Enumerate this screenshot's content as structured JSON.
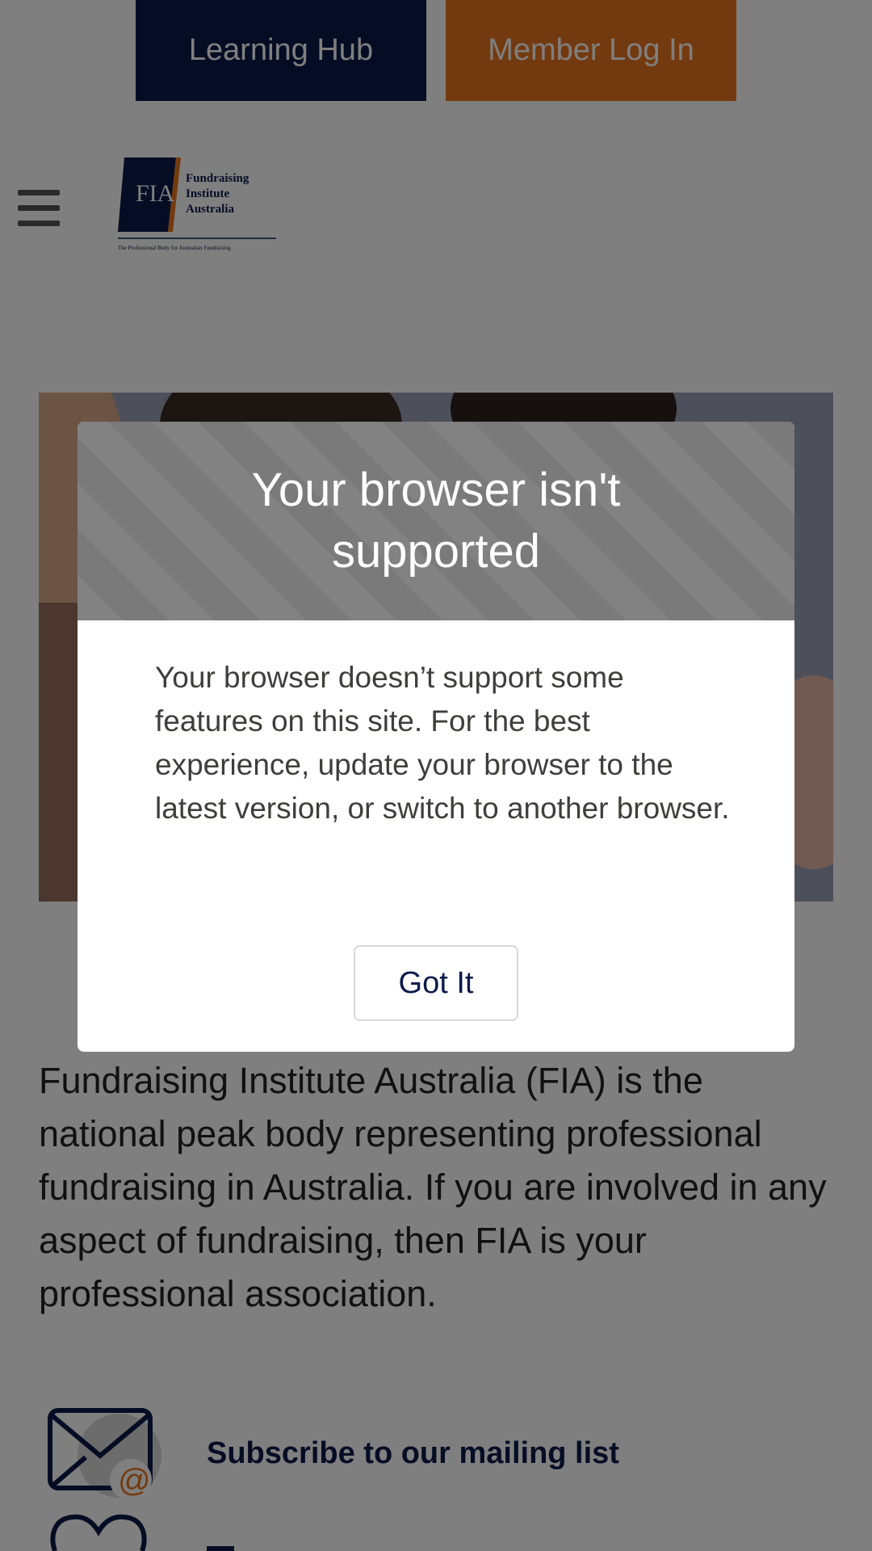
{
  "top_buttons": {
    "learning_hub": "Learning Hub",
    "member_login": "Member Log In"
  },
  "logo": {
    "mark": "FIA",
    "line1": "Fundraising",
    "line2": "Institute",
    "line3": "Australia",
    "tagline": "The Professional Body for Australian Fundraising"
  },
  "intro_text": "Fundraising Institute Australia (FIA) is the national peak body representing professional fundraising in Australia. If you are involved in any aspect of fundraising, then FIA is your professional association.",
  "links": {
    "subscribe": "Subscribe to our mailing list"
  },
  "modal": {
    "title": "Your browser isn't supported",
    "body": "Your browser doesn’t support some features on this site. For the best experience, update your browser to the latest version, or switch to another browser.",
    "button": "Got It"
  },
  "colors": {
    "navy": "#0a1a4a",
    "orange": "#e8741f"
  }
}
